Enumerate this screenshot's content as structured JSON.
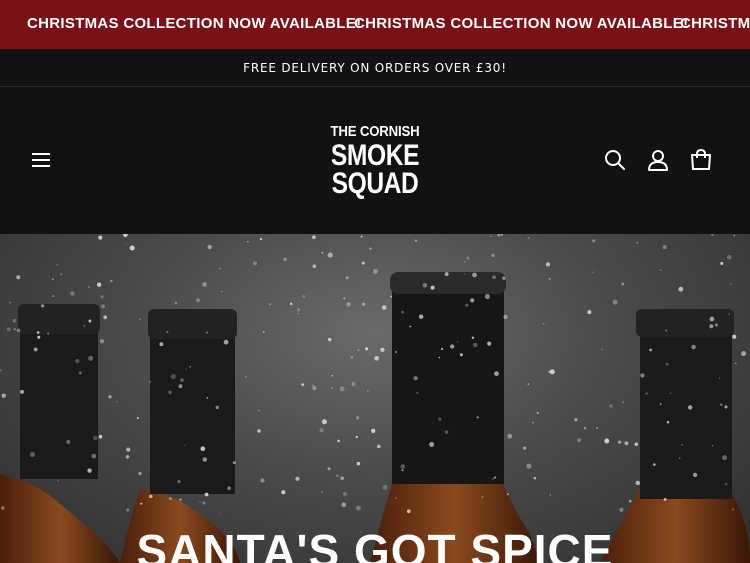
{
  "announcement": {
    "items": [
      "CHRISTMAS COLLECTION NOW AVAILABLE!",
      "CHRISTMAS COLLECTION NOW AVAILABLE!",
      "CHRISTMAS COLLECTION NOW AVAILABLE!"
    ],
    "background": "#7a1116"
  },
  "delivery": {
    "text": "FREE DELIVERY ON ORDERS OVER £30!"
  },
  "header": {
    "logo": {
      "line1": "THE CORNISH",
      "line2": "SMOKE",
      "line3": "SQUAD"
    },
    "icons": [
      "menu-icon",
      "search-icon",
      "account-icon",
      "cart-icon"
    ]
  },
  "hero": {
    "title": "SANTA'S GOT SPICE"
  }
}
